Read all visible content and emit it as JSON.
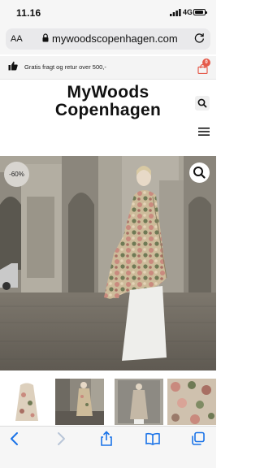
{
  "status_bar": {
    "time": "11.16",
    "network": "4G"
  },
  "browser": {
    "text_size_label": "AA",
    "url": "mywoodscopenhagen.com"
  },
  "promo": {
    "text": "Gratis fragt og retur over 500,-",
    "cart_count": "0"
  },
  "brand": {
    "line1": "MyWoods",
    "line2": "Copenhagen"
  },
  "product": {
    "discount_badge": "-60%"
  },
  "colors": {
    "badge_red": "#e55a4a",
    "ios_blue": "#1a73e8",
    "bar_bg": "#f6f6f6"
  },
  "icons": [
    "signal-icon",
    "battery-icon",
    "lock-icon",
    "reload-icon",
    "thumbs-up-icon",
    "shopping-bag-icon",
    "search-icon",
    "hamburger-menu-icon",
    "zoom-icon",
    "back-icon",
    "forward-icon",
    "share-icon",
    "bookmarks-icon",
    "tabs-icon"
  ]
}
